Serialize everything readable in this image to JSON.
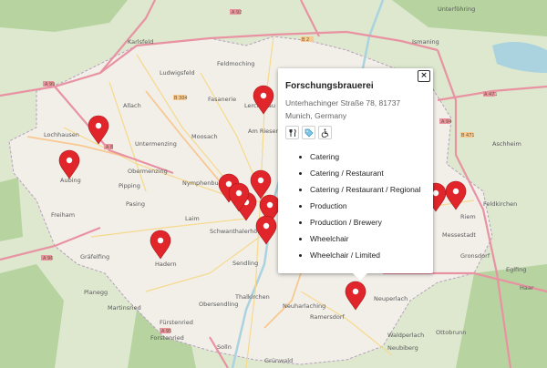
{
  "map": {
    "places": [
      {
        "name": "Karlsfeld"
      },
      {
        "name": "Ludwigsfeld"
      },
      {
        "name": "Feldmoching"
      },
      {
        "name": "Fasanerie"
      },
      {
        "name": "Lerchenau"
      },
      {
        "name": "Allach"
      },
      {
        "name": "Lochhausen"
      },
      {
        "name": "Untermenzing"
      },
      {
        "name": "Moosach"
      },
      {
        "name": "Am Riesenfeld"
      },
      {
        "name": "Obermenzing"
      },
      {
        "name": "Aubing"
      },
      {
        "name": "Pipping"
      },
      {
        "name": "Nymphenburg"
      },
      {
        "name": "Pasing"
      },
      {
        "name": "Freiham"
      },
      {
        "name": "Laim"
      },
      {
        "name": "Schwanthalerhöhe"
      },
      {
        "name": "Gräfelfing"
      },
      {
        "name": "Hadern"
      },
      {
        "name": "Sendling"
      },
      {
        "name": "Planegg"
      },
      {
        "name": "Martinsried"
      },
      {
        "name": "Obersendling"
      },
      {
        "name": "Thalkirchen"
      },
      {
        "name": "Fürstenried"
      },
      {
        "name": "Forstenried"
      },
      {
        "name": "Neuharlaching"
      },
      {
        "name": "Ramersdorf"
      },
      {
        "name": "Neuperlach"
      },
      {
        "name": "Waldperlach"
      },
      {
        "name": "Ottobrunn"
      },
      {
        "name": "Neubiberg"
      },
      {
        "name": "Messestadt"
      },
      {
        "name": "Feldkirchen"
      },
      {
        "name": "Haar"
      },
      {
        "name": "Ismaning"
      },
      {
        "name": "Unterföhring"
      },
      {
        "name": "Aschheim"
      },
      {
        "name": "Solln"
      },
      {
        "name": "Grünwald"
      },
      {
        "name": "Riem"
      },
      {
        "name": "Gronsdorf"
      },
      {
        "name": "Eglfing"
      }
    ],
    "roads": [
      "A 99",
      "A 8",
      "A 92",
      "A 96",
      "A 95",
      "A 94",
      "A 471",
      "B 304",
      "B 2",
      "B 471"
    ],
    "colors": {
      "city_area": "#f2efe9",
      "outside": "#dde8cf",
      "forest": "#b6d3a0",
      "water": "#aad3df",
      "motorway": "#e892a2",
      "trunk": "#f8c891",
      "secondary": "#f6fabb",
      "marker": "#e0262a"
    },
    "marker_count": 13
  },
  "popup": {
    "close_label": "×",
    "title": "Forschungsbrauerei",
    "address": "Unterhachinger Straße 78, 81737 Munich, Germany",
    "icons": [
      "restaurant-icon",
      "tag-icon",
      "wheelchair-icon"
    ],
    "tags": [
      "Catering",
      "Catering / Restaurant",
      "Catering / Restaurant / Regional",
      "Production",
      "Production / Brewery",
      "Wheelchair",
      "Wheelchair / Limited"
    ]
  }
}
